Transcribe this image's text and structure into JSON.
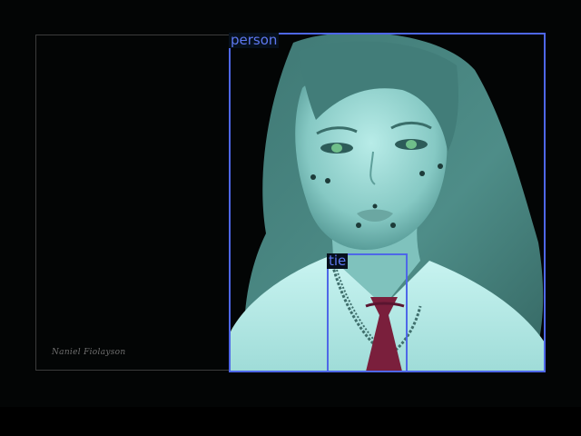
{
  "signature_text": "Naniel Fiolayson",
  "detections": [
    {
      "label": "person",
      "color": "#4e67e8"
    },
    {
      "label": "tie",
      "color": "#4e67e8"
    }
  ],
  "colors": {
    "background": "#030505",
    "mask_tint": "#4c9a96",
    "box": "#4e67e8",
    "tie": "#7a1f3c"
  }
}
